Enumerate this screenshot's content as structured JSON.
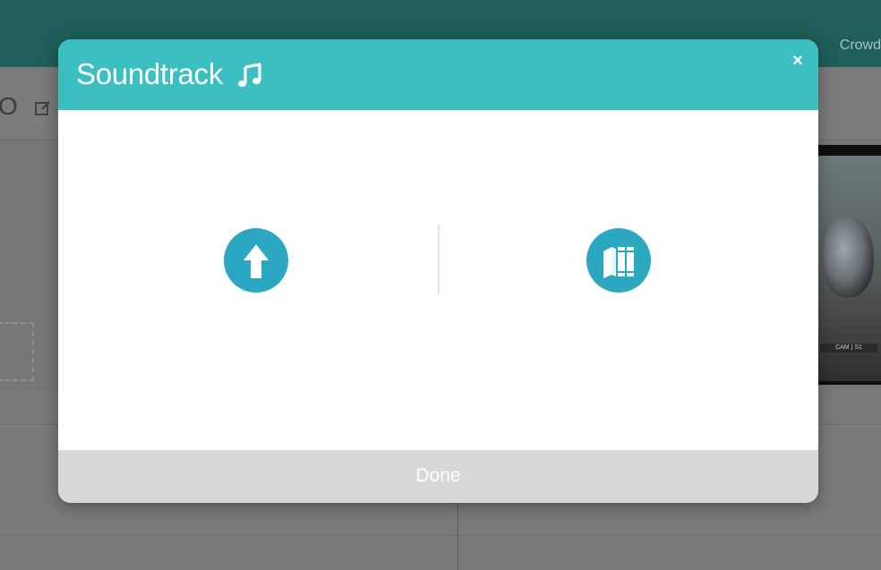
{
  "app": {
    "nav_link": "Crowd",
    "toolbar_letter": "O",
    "video_tag": "CAM  |  S1"
  },
  "modal": {
    "title": "Soundtrack",
    "close_label": "×",
    "options": [
      {
        "name": "upload",
        "icon": "upload-arrow-icon"
      },
      {
        "name": "library",
        "icon": "books-library-icon"
      }
    ],
    "footer_label": "Done"
  },
  "colors": {
    "accent": "#3bbfc1",
    "option_circle": "#2ba7c2",
    "footer": "#d8d8d8"
  }
}
